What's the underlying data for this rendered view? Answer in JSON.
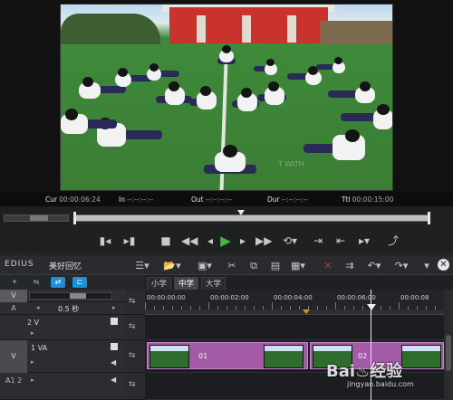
{
  "timecodes": {
    "cur_label": "Cur",
    "cur_value": "00:00:06:24",
    "in_label": "In",
    "in_value": "--:--:--:--",
    "out_label": "Out",
    "out_value": "--:--:--:--",
    "dur_label": "Dur",
    "dur_value": "--:--:--:--",
    "ttl_label": "Ttl",
    "ttl_value": "00:00:15:00"
  },
  "preview_overlay_text": "T WITH",
  "header": {
    "app_name": "EDIUS",
    "project_name": "美好回忆"
  },
  "track_panel": {
    "zoom_value": "0.5 秒",
    "tracks": [
      {
        "label": "2 V"
      },
      {
        "label": "1 VA"
      },
      {
        "label": "A1 2"
      }
    ],
    "top_row_label": "V",
    "second_row_label": "A"
  },
  "sequence_tabs": [
    {
      "label": "小学"
    },
    {
      "label": "中学"
    },
    {
      "label": "大学"
    }
  ],
  "ruler": {
    "labels": [
      "00:00:00:00",
      "00:00:02:00",
      "00:00:04:00",
      "00:00:06:00",
      "00:00:08"
    ]
  },
  "clips": [
    {
      "label": "01"
    },
    {
      "label": "02"
    }
  ],
  "watermark": {
    "main": "Bai♨经验",
    "sub": "jingyan.baidu.com"
  },
  "icons": {
    "play": "play-icon",
    "stop": "stop-icon",
    "close": "close-icon"
  },
  "colors": {
    "clip": "#a35aa7",
    "play": "#3fbd3a",
    "accent_blue": "#1f8fd6"
  }
}
